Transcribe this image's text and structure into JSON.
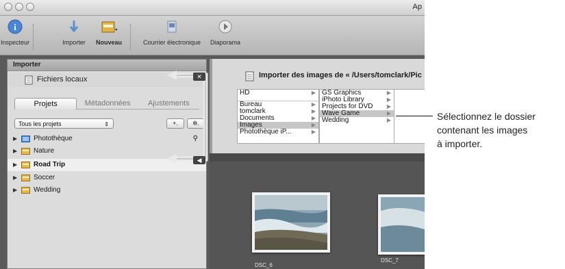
{
  "window": {
    "title": "Ap"
  },
  "toolbar": {
    "items": [
      {
        "label": "Inspecteur",
        "icon": "info-icon"
      },
      {
        "label": "Importer",
        "icon": "import-arrow-icon"
      },
      {
        "label": "Nouveau",
        "icon": "new-project-icon"
      },
      {
        "label": "Courrier électronique",
        "icon": "email-icon"
      },
      {
        "label": "Diaporama",
        "icon": "play-icon"
      }
    ]
  },
  "importer": {
    "header": "Importer",
    "source": "Fichiers locaux",
    "import_title": "Importer des images de « /Users/tomclark/Pic"
  },
  "tabs": [
    "Projets",
    "Métadonnées",
    "Ajustements"
  ],
  "project_selector": {
    "value": "Tous les projets"
  },
  "buttons": {
    "add": "+.",
    "action": "✲."
  },
  "projects": [
    {
      "label": "Photothèque",
      "icon": "photo-library-icon",
      "selected": false
    },
    {
      "label": "Nature",
      "icon": "folder-icon",
      "selected": false
    },
    {
      "label": "Road Trip",
      "icon": "folder-icon",
      "selected": true
    },
    {
      "label": "Soccer",
      "icon": "folder-icon",
      "selected": false
    },
    {
      "label": "Wedding",
      "icon": "folder-icon",
      "selected": false
    }
  ],
  "browser": {
    "col1": [
      "HD",
      "",
      "Bureau",
      "tomclark",
      "Documents",
      "Images",
      "Photothèque iP..."
    ],
    "col1_selected": "Images",
    "col2": [
      "GS Graphics",
      "iPhoto Library",
      "Projects for DVD",
      "Wave Game",
      "Wedding"
    ],
    "col2_selected": "Wave Game"
  },
  "thumbnails": [
    {
      "label": "DSC_6"
    },
    {
      "label": "DSC_7"
    }
  ],
  "callout": {
    "line1": "Sélectionnez le dossier",
    "line2": "contenant les images",
    "line3": "à importer."
  },
  "colors": {
    "accent": "#3a7fd0",
    "folder": "#e6b84a",
    "selected_row": "#c7c7c7"
  }
}
